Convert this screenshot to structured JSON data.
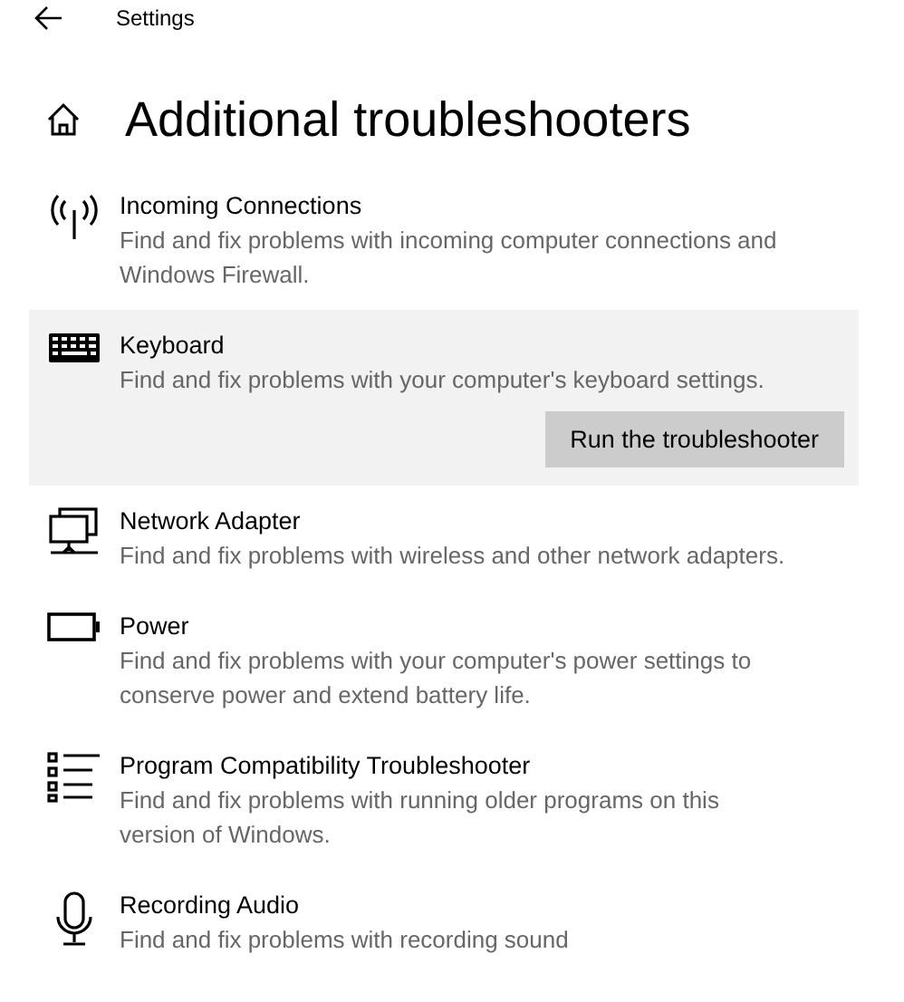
{
  "window": {
    "title": "Settings"
  },
  "page": {
    "title": "Additional troubleshooters"
  },
  "troubleshooters": [
    {
      "kind": "antenna",
      "title": "Incoming Connections",
      "description": "Find and fix problems with incoming computer connections and Windows Firewall.",
      "selected": false
    },
    {
      "kind": "keyboard",
      "title": "Keyboard",
      "description": "Find and fix problems with your computer's keyboard settings.",
      "selected": true,
      "action": "Run the troubleshooter"
    },
    {
      "kind": "computers",
      "title": "Network Adapter",
      "description": "Find and fix problems with wireless and other network adapters.",
      "selected": false
    },
    {
      "kind": "battery",
      "title": "Power",
      "description": "Find and fix problems with your computer's power settings to conserve power and extend battery life.",
      "selected": false
    },
    {
      "kind": "list",
      "title": "Program Compatibility Troubleshooter",
      "description": "Find and fix problems with running older programs on this version of Windows.",
      "selected": false
    },
    {
      "kind": "microphone",
      "title": "Recording Audio",
      "description": "Find and fix problems with recording sound",
      "selected": false
    }
  ]
}
